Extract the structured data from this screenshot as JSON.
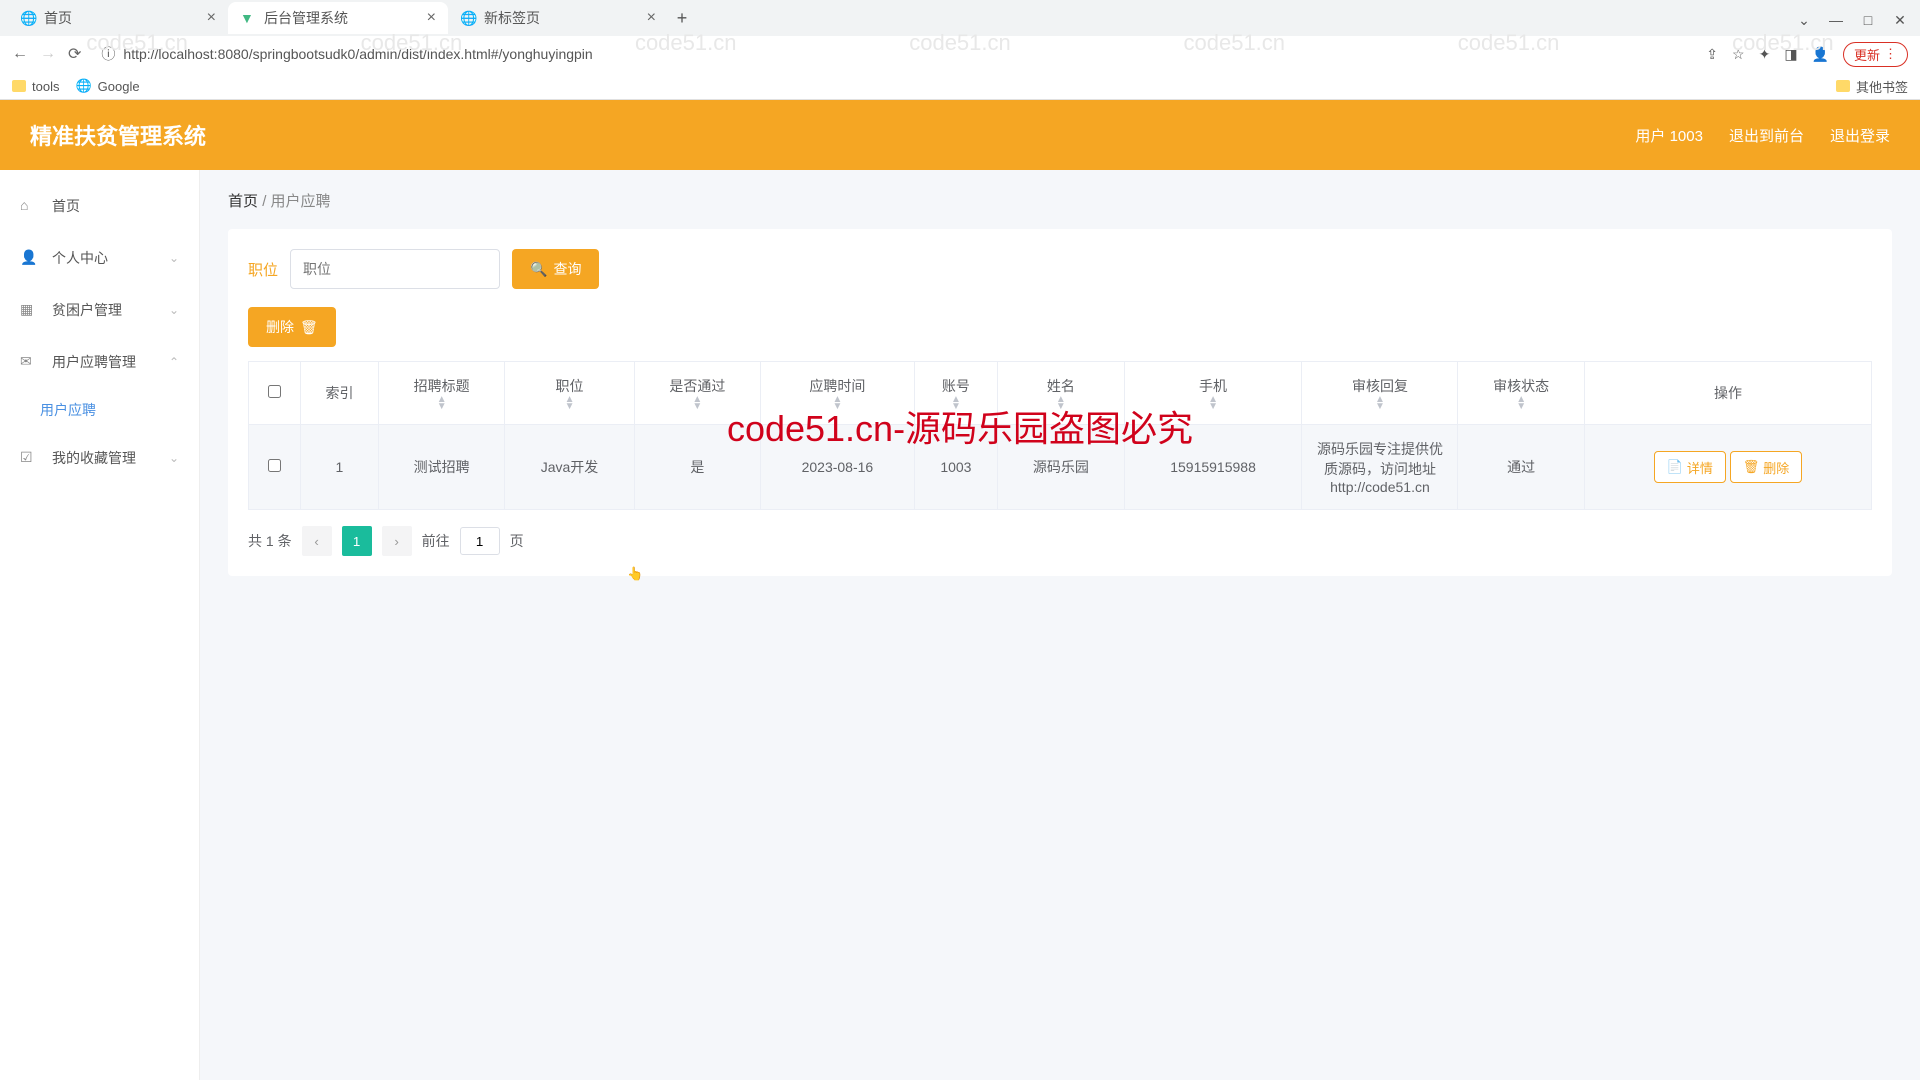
{
  "browser": {
    "tabs": [
      {
        "title": "首页",
        "active": false
      },
      {
        "title": "后台管理系统",
        "active": true
      },
      {
        "title": "新标签页",
        "active": false
      }
    ],
    "url": "http://localhost:8080/springbootsudk0/admin/dist/index.html#/yonghuyingpin",
    "update_label": "更新",
    "bookmarks_left": [
      {
        "label": "tools",
        "folder": true
      },
      {
        "label": "Google",
        "folder": false
      }
    ],
    "bookmarks_right": {
      "label": "其他书签"
    }
  },
  "app": {
    "title": "精准扶贫管理系统",
    "nav": {
      "user": "用户 1003",
      "front": "退出到前台",
      "logout": "退出登录"
    }
  },
  "sidebar": {
    "items": [
      {
        "label": "首页",
        "icon": "home"
      },
      {
        "label": "个人中心",
        "icon": "user",
        "expand": true
      },
      {
        "label": "贫困户管理",
        "icon": "grid",
        "expand": true
      },
      {
        "label": "用户应聘管理",
        "icon": "mail",
        "expand": true,
        "open": true
      },
      {
        "label": "用户应聘",
        "sub": true
      },
      {
        "label": "我的收藏管理",
        "icon": "check",
        "expand": true
      }
    ]
  },
  "breadcrumb": {
    "home": "首页",
    "sep": "/",
    "page": "用户应聘"
  },
  "search": {
    "label": "职位",
    "placeholder": "职位",
    "btn": "查询"
  },
  "delete_btn": "删除",
  "table": {
    "headers": [
      "索引",
      "招聘标题",
      "职位",
      "是否通过",
      "应聘时间",
      "账号",
      "姓名",
      "手机",
      "审核回复",
      "审核状态",
      "操作"
    ],
    "rows": [
      {
        "index": "1",
        "title": "测试招聘",
        "position": "Java开发",
        "pass": "是",
        "date": "2023-08-16",
        "account": "1003",
        "name": "源码乐园",
        "phone": "15915915988",
        "reply": "源码乐园专注提供优质源码，访问地址http://code51.cn",
        "status": "通过"
      }
    ],
    "detail_btn": "详情",
    "del_btn": "删除"
  },
  "pager": {
    "total_prefix": "共",
    "total_count": "1",
    "total_suffix": "条",
    "page": "1",
    "goto": "前往",
    "unit": "页"
  },
  "watermark": {
    "text": "code51.cn",
    "red": "code51.cn-源码乐园盗图必究"
  }
}
